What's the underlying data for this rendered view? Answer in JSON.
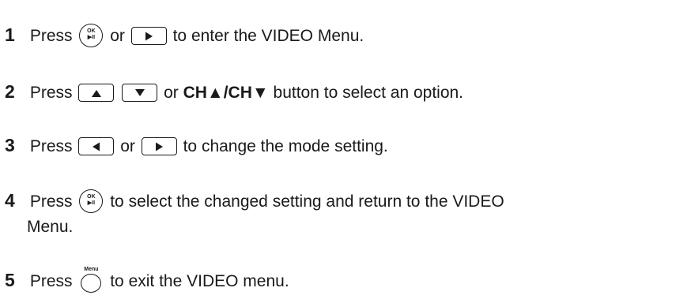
{
  "steps": [
    {
      "number": "1",
      "parts": {
        "press": "Press",
        "or": "or",
        "rest": "to enter the VIDEO Menu."
      }
    },
    {
      "number": "2",
      "parts": {
        "press": "Press",
        "or": "or",
        "ch": "CH▲/CH▼",
        "rest": "button to select an option."
      }
    },
    {
      "number": "3",
      "parts": {
        "press": "Press",
        "or": "or",
        "rest": "to change the mode setting."
      }
    },
    {
      "number": "4",
      "parts": {
        "press": "Press",
        "rest": "to select the changed setting and return to the VIDEO",
        "cont": "Menu."
      }
    },
    {
      "number": "5",
      "parts": {
        "press": "Press",
        "rest": "to exit the VIDEO menu."
      }
    }
  ],
  "buttons": {
    "ok_top": "OK",
    "ok_bottom": "▶II",
    "menu_label": "Menu"
  },
  "icons": {
    "ok_play": "ok-play-button-icon",
    "right": "right-arrow-button-icon",
    "left": "left-arrow-button-icon",
    "up": "up-arrow-button-icon",
    "down": "down-arrow-button-icon",
    "menu": "menu-button-icon"
  }
}
